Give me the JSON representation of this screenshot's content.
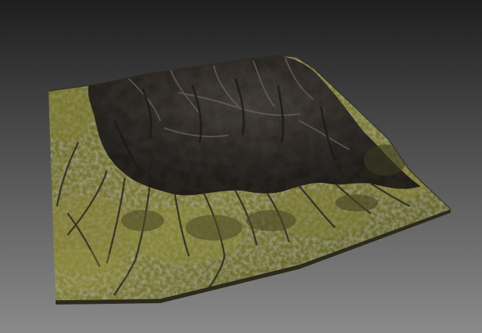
{
  "scene": {
    "subject": "terrain-mesh-render",
    "background": {
      "top": "#1e1e1e",
      "bottom": "#8a8a8a"
    },
    "colors": {
      "grass": "#6b6a2a",
      "grass_light": "#8c8a3a",
      "grass_dark": "#3f4220",
      "rock": "#3a3632",
      "rock_dark": "#24211f",
      "rock_light": "#5a544c",
      "shadow": "#141312"
    }
  }
}
